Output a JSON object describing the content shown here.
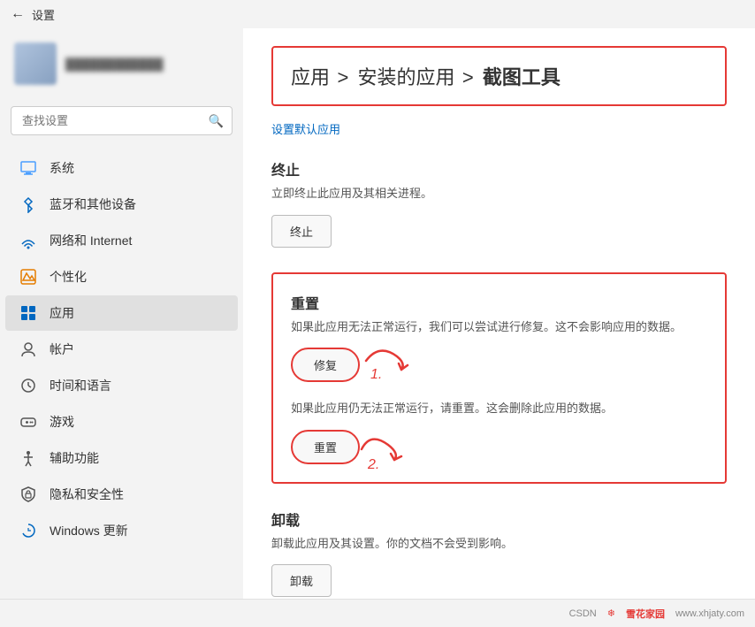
{
  "titleBar": {
    "backIcon": "←",
    "title": "设置"
  },
  "sidebar": {
    "searchPlaceholder": "查找设置",
    "searchIcon": "🔍",
    "userName": "用户名",
    "items": [
      {
        "id": "system",
        "label": "系统",
        "icon": "system"
      },
      {
        "id": "bluetooth",
        "label": "蓝牙和其他设备",
        "icon": "bluetooth"
      },
      {
        "id": "network",
        "label": "网络和 Internet",
        "icon": "network"
      },
      {
        "id": "personalization",
        "label": "个性化",
        "icon": "personalization"
      },
      {
        "id": "apps",
        "label": "应用",
        "icon": "apps",
        "active": true
      },
      {
        "id": "accounts",
        "label": "帐户",
        "icon": "accounts"
      },
      {
        "id": "time",
        "label": "时间和语言",
        "icon": "time"
      },
      {
        "id": "gaming",
        "label": "游戏",
        "icon": "gaming"
      },
      {
        "id": "accessibility",
        "label": "辅助功能",
        "icon": "accessibility"
      },
      {
        "id": "privacy",
        "label": "隐私和安全性",
        "icon": "privacy"
      },
      {
        "id": "windows-update",
        "label": "Windows 更新",
        "icon": "update"
      }
    ]
  },
  "content": {
    "breadcrumb": {
      "part1": "应用",
      "separator1": ">",
      "part2": "安装的应用",
      "separator2": ">",
      "part3": "截图工具"
    },
    "defaultAppLink": "设置默认应用",
    "terminateSection": {
      "title": "终止",
      "desc": "立即终止此应用及其相关进程。",
      "buttonLabel": "终止"
    },
    "resetSection": {
      "title": "重置",
      "repairDesc": "如果此应用无法正常运行，我们可以尝试进行修复。这不会影响应用的数据。",
      "repairButton": "修复",
      "resetDesc": "如果此应用仍无法正常运行，请重置。这会删除此应用的数据。",
      "resetButton": "重置"
    },
    "uninstallSection": {
      "title": "卸载",
      "desc": "卸载此应用及其设置。你的文档不会受到影响。",
      "buttonLabel": "卸载"
    }
  },
  "bottomBar": {
    "csdnText": "CSDN",
    "snowflakeText": "❄ 雪花家园",
    "siteText": "www.xhjaty.com"
  }
}
